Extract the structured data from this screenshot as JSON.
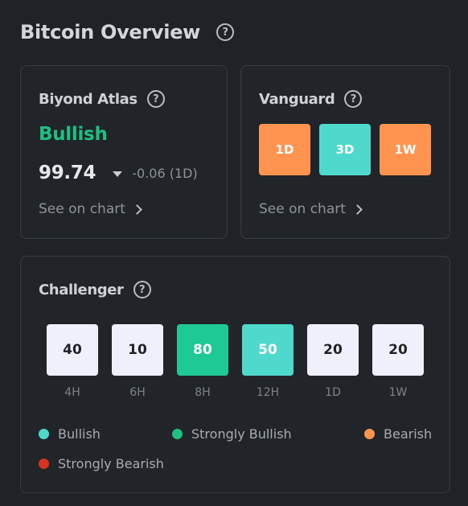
{
  "page": {
    "title": "Bitcoin Overview",
    "help_glyph": "?"
  },
  "atlas": {
    "title": "Biyond Atlas",
    "sentiment": "Bullish",
    "score": "99.74",
    "change": "-0.06 (1D)",
    "see_chart": "See on chart",
    "sentiment_color": "#1fbf82",
    "direction_icon": "caret-down-icon"
  },
  "vanguard": {
    "title": "Vanguard",
    "see_chart": "See on chart",
    "timeframes": [
      {
        "label": "1D",
        "color": "#ff9450"
      },
      {
        "label": "3D",
        "color": "#4fd9cd"
      },
      {
        "label": "1W",
        "color": "#ff9450"
      }
    ]
  },
  "challenger": {
    "title": "Challenger",
    "cells": [
      {
        "value": "40",
        "label": "4H",
        "bg": "#eef0fb",
        "fg": "#1f2327"
      },
      {
        "value": "10",
        "label": "6H",
        "bg": "#eef0fb",
        "fg": "#1f2327"
      },
      {
        "value": "80",
        "label": "8H",
        "bg": "#1fc995",
        "fg": "#ffffff"
      },
      {
        "value": "50",
        "label": "12H",
        "bg": "#4fd9cd",
        "fg": "#ffffff"
      },
      {
        "value": "20",
        "label": "1D",
        "bg": "#eef0fb",
        "fg": "#1f2327"
      },
      {
        "value": "20",
        "label": "1W",
        "bg": "#eef0fb",
        "fg": "#1f2327"
      }
    ],
    "legend": [
      {
        "label": "Bullish",
        "color": "#4fd9cd"
      },
      {
        "label": "Strongly Bullish",
        "color": "#1fbf82"
      },
      {
        "label": "Bearish",
        "color": "#ff9450"
      },
      {
        "label": "Strongly Bearish",
        "color": "#d8331f"
      }
    ]
  }
}
